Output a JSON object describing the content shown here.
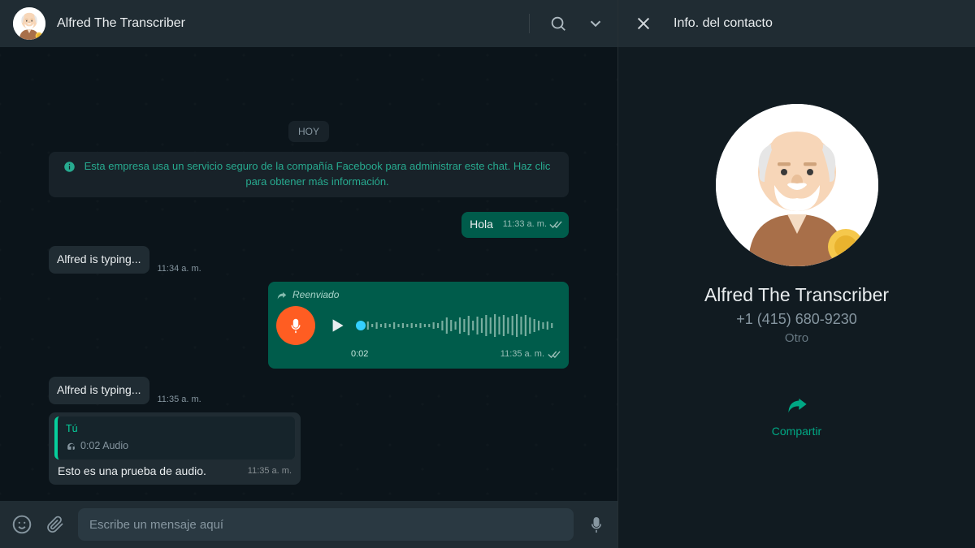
{
  "header": {
    "contact_name": "Alfred The Transcriber"
  },
  "chat": {
    "date_label": "HOY",
    "info_banner": "Esta empresa usa un servicio seguro de la compañía Facebook para administrar este chat. Haz clic para obtener más información.",
    "msg_out1": {
      "text": "Hola",
      "time": "11:33 a. m."
    },
    "typing1": {
      "text": "Alfred is typing...",
      "time": "11:34 a. m."
    },
    "voice": {
      "forwarded_label": "Reenviado",
      "duration": "0:02",
      "time": "11:35 a. m."
    },
    "typing2": {
      "text": "Alfred is typing...",
      "time": "11:35 a. m."
    },
    "reply": {
      "quote_who": "Tú",
      "quote_what": "0:02 Audio",
      "text": "Esto es una prueba de audio.",
      "time": "11:35 a. m."
    }
  },
  "composer": {
    "placeholder": "Escribe un mensaje aquí"
  },
  "info_panel": {
    "title": "Info. del contacto",
    "name": "Alfred The Transcriber",
    "phone": "+1 (415) 680-9230",
    "tag": "Otro",
    "share_label": "Compartir"
  }
}
